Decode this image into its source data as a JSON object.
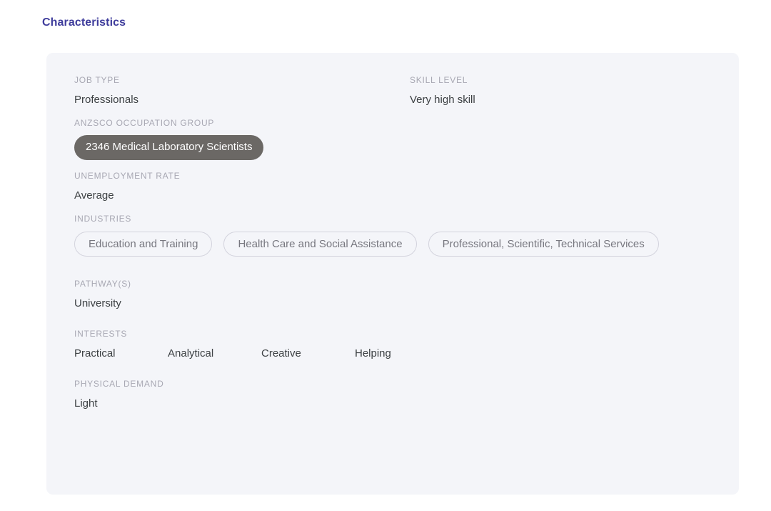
{
  "page": {
    "title": "Characteristics",
    "title_color": "#3f3d9c",
    "card_background": "#f4f5f9",
    "label_color": "#a8a8b3",
    "value_color": "#3c4043",
    "dark_pill_color": "#6b6865",
    "outline_pill_border": "#d3d3dd",
    "outline_pill_text": "#77777f"
  },
  "fields": {
    "job_type": {
      "label": "JOB TYPE",
      "value": "Professionals"
    },
    "skill_level": {
      "label": "SKILL LEVEL",
      "value": "Very high skill"
    },
    "anzsco_occupation_group": {
      "label": "ANZSCO OCCUPATION GROUP",
      "tag": "2346 Medical Laboratory Scientists"
    },
    "unemployment_rate": {
      "label": "UNEMPLOYMENT RATE",
      "value": "Average"
    },
    "industries": {
      "label": "INDUSTRIES",
      "tags": [
        "Education and Training",
        "Health Care and Social Assistance",
        "Professional, Scientific, Technical Services"
      ]
    },
    "pathways": {
      "label": "PATHWAY(S)",
      "value": "University"
    },
    "interests": {
      "label": "INTERESTS",
      "items": [
        "Practical",
        "Analytical",
        "Creative",
        "Helping"
      ]
    },
    "physical_demand": {
      "label": "PHYSICAL DEMAND",
      "value": "Light"
    }
  }
}
